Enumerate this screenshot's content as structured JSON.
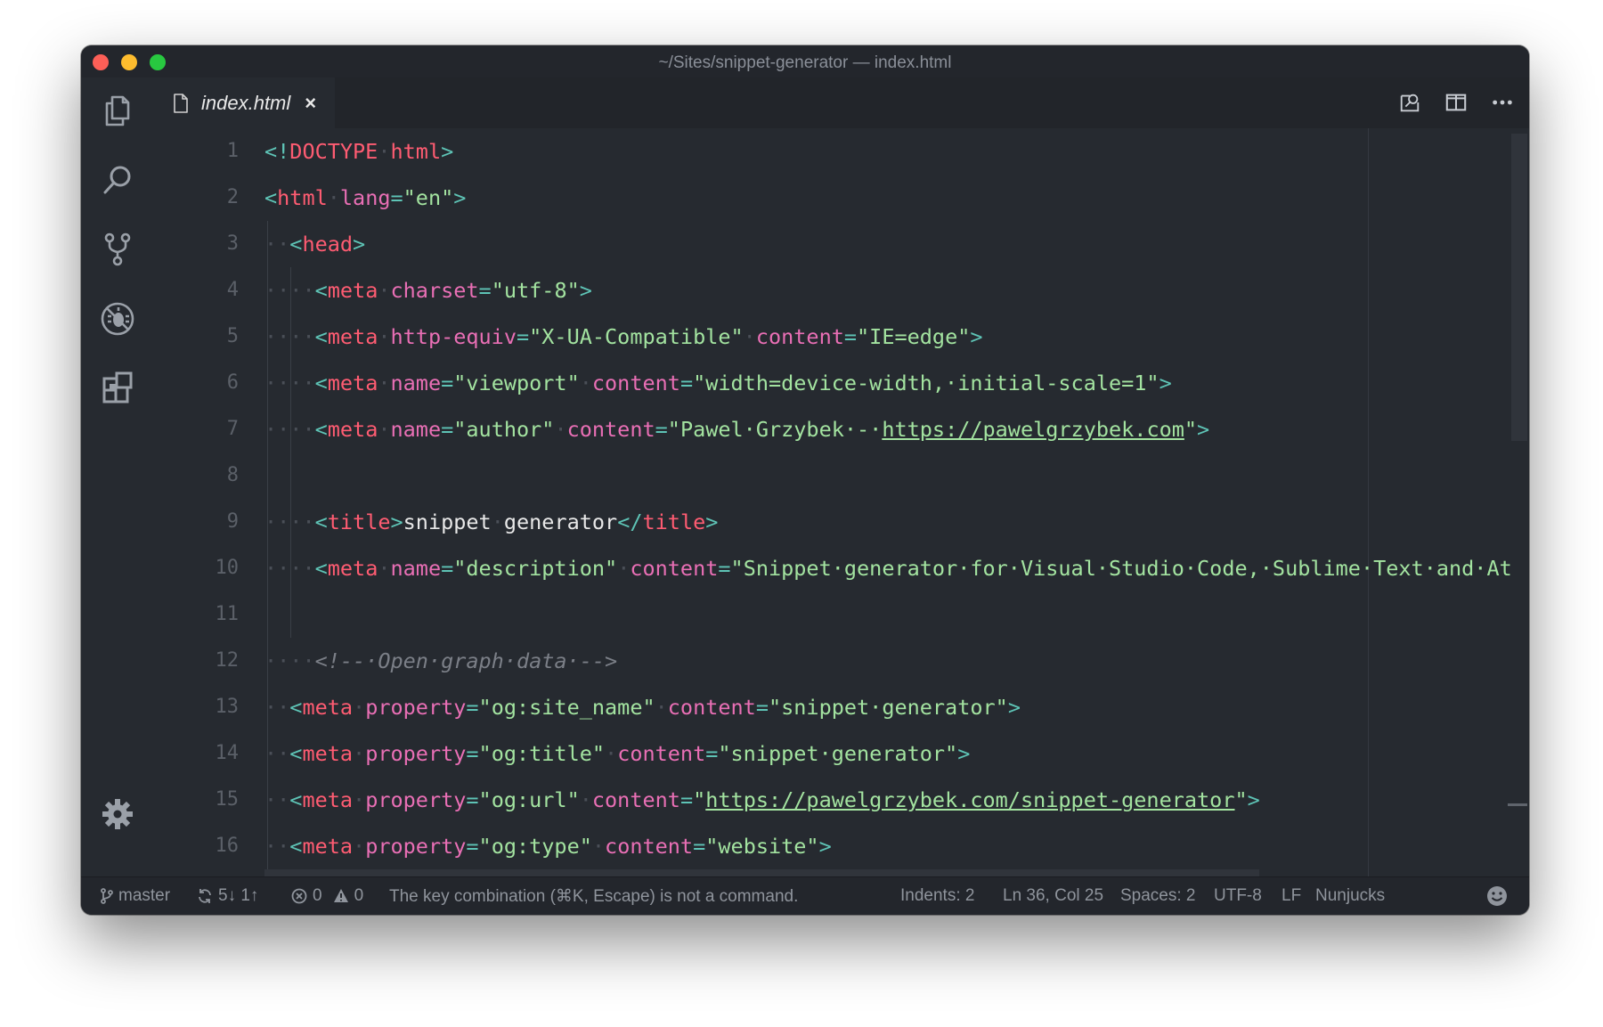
{
  "window": {
    "title": "~/Sites/snippet-generator — index.html"
  },
  "activity": [
    {
      "name": "explorer-icon"
    },
    {
      "name": "search-icon"
    },
    {
      "name": "source-control-icon"
    },
    {
      "name": "debug-icon"
    },
    {
      "name": "extensions-icon"
    },
    {
      "name": "settings-gear-icon"
    }
  ],
  "tab": {
    "label": "index.html",
    "close": "×"
  },
  "editor": {
    "lines": [
      "1",
      "2",
      "3",
      "4",
      "5",
      "6",
      "7",
      "8",
      "9",
      "10",
      "11",
      "12",
      "13",
      "14",
      "15",
      "16"
    ],
    "code": {
      "l1": [
        "<!",
        "DOCTYPE",
        "·",
        "html",
        ">"
      ],
      "l2": [
        "<",
        "html",
        "·",
        "lang",
        "=",
        "\"en\"",
        ">"
      ],
      "l3": [
        "··",
        "<",
        "head",
        ">"
      ],
      "l4": [
        "····",
        "<",
        "meta",
        "·",
        "charset",
        "=",
        "\"utf-8\"",
        ">"
      ],
      "l5": [
        "····",
        "<",
        "meta",
        "·",
        "http-equiv",
        "=",
        "\"X-UA-Compatible\"",
        "·",
        "content",
        "=",
        "\"IE=edge\"",
        ">"
      ],
      "l6": [
        "····",
        "<",
        "meta",
        "·",
        "name",
        "=",
        "\"viewport\"",
        "·",
        "content",
        "=",
        "\"width=device-width,·initial-scale=1\"",
        ">"
      ],
      "l7": [
        "····",
        "<",
        "meta",
        "·",
        "name",
        "=",
        "\"author\"",
        "·",
        "content",
        "=",
        "\"Pawel·Grzybek·-·",
        "https://pawelgrzybek.com",
        "\"",
        ">"
      ],
      "l9": [
        "····",
        "<",
        "title",
        ">",
        "snippet",
        "·",
        "generator",
        "</",
        "title",
        ">"
      ],
      "l10": [
        "····",
        "<",
        "meta",
        "·",
        "name",
        "=",
        "\"description\"",
        "·",
        "content",
        "=",
        "\"Snippet·generator·for·Visual·Studio·Code,·Sublime·Text·and·At"
      ],
      "l12": [
        "····",
        "<!--·Open·graph·data·-->"
      ],
      "l13": [
        "··",
        "<",
        "meta",
        "·",
        "property",
        "=",
        "\"og:site_name\"",
        "·",
        "content",
        "=",
        "\"snippet·generator\"",
        ">"
      ],
      "l14": [
        "··",
        "<",
        "meta",
        "·",
        "property",
        "=",
        "\"og:title\"",
        "·",
        "content",
        "=",
        "\"snippet·generator\"",
        ">"
      ],
      "l15": [
        "··",
        "<",
        "meta",
        "·",
        "property",
        "=",
        "\"og:url\"",
        "·",
        "content",
        "=",
        "\"",
        "https://pawelgrzybek.com/snippet-generator",
        "\"",
        ">"
      ],
      "l16": [
        "··",
        "<",
        "meta",
        "·",
        "property",
        "=",
        "\"og:type\"",
        "·",
        "content",
        "=",
        "\"website\"",
        ">"
      ]
    }
  },
  "status": {
    "branch": "master",
    "sync": "5↓ 1↑",
    "errors": "0",
    "warnings": "0",
    "message": "The key combination (⌘K, Escape) is not a command.",
    "indents": "Indents: 2",
    "position": "Ln 36, Col 25",
    "spaces": "Spaces: 2",
    "encoding": "UTF-8",
    "eol": "LF",
    "language": "Nunjucks"
  },
  "colors": {
    "background": "#262a30",
    "tag": "#ff5c72",
    "attribute": "#e96fb5",
    "string": "#a3e3a0",
    "punctuation": "#5ec4b6",
    "comment": "#7b7f87"
  }
}
